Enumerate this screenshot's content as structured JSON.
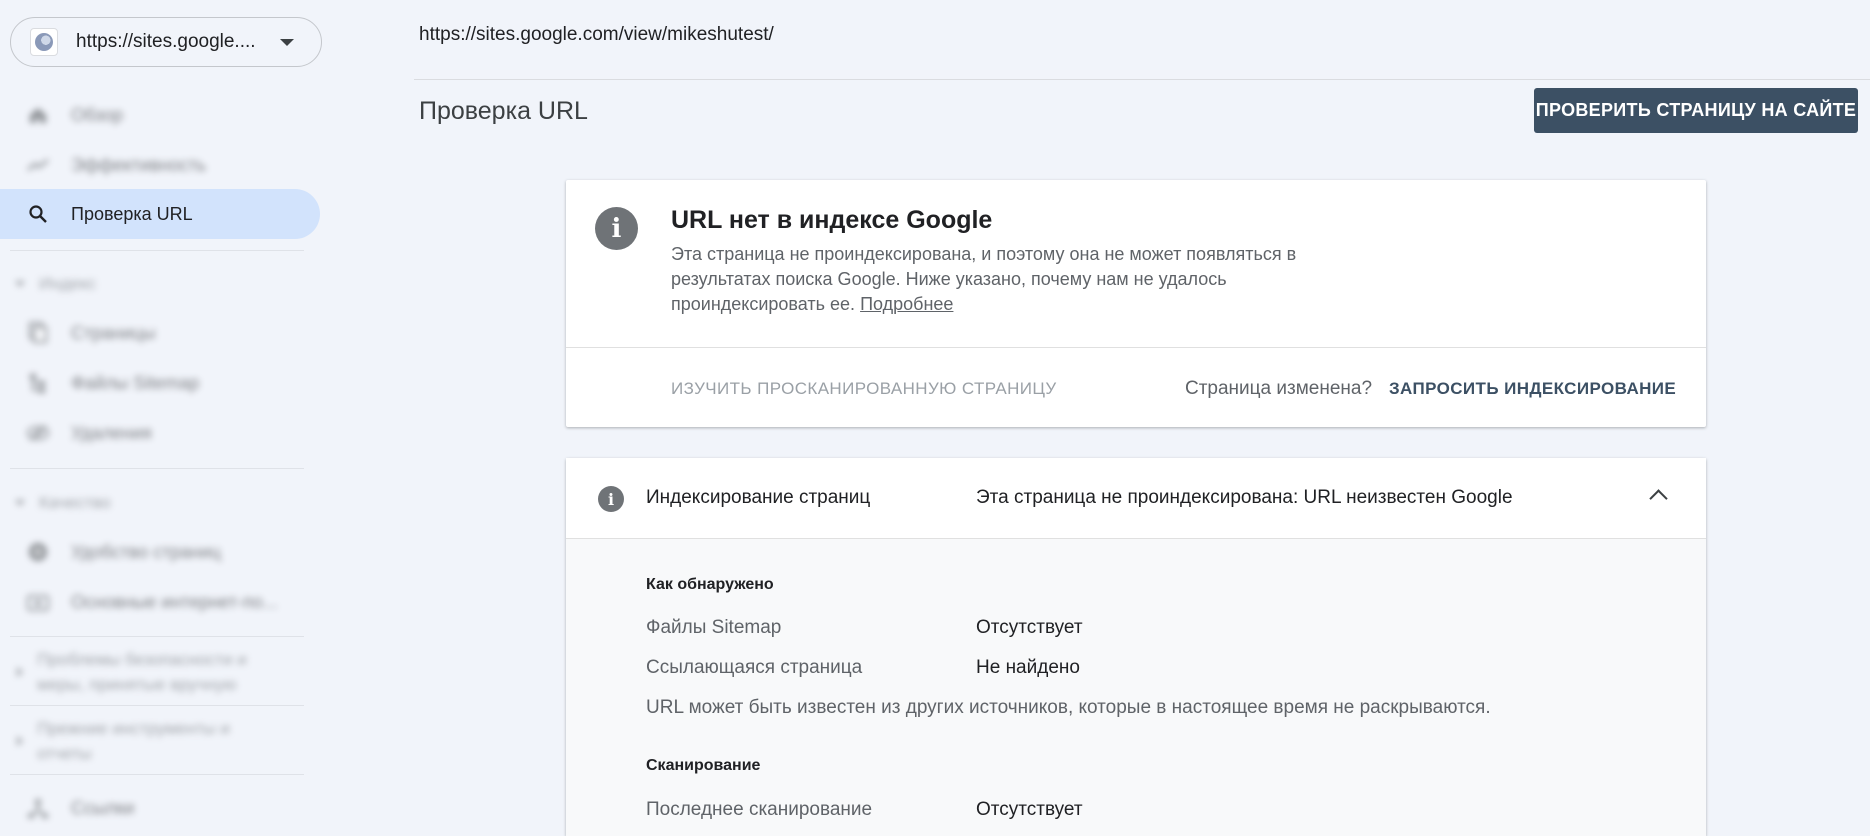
{
  "property": {
    "name": "https://sites.google....",
    "icon": "globe-icon"
  },
  "sidebar": {
    "items": [
      {
        "label": "Обзор",
        "icon": "home-icon"
      },
      {
        "label": "Эффективность",
        "icon": "trending-icon"
      },
      {
        "label": "Проверка URL",
        "icon": "search-icon"
      },
      {
        "label": "Страницы",
        "icon": "pages-icon"
      },
      {
        "label": "Файлы Sitemap",
        "icon": "sitemap-icon"
      },
      {
        "label": "Удаления",
        "icon": "removals-icon"
      },
      {
        "label": "Удобство страниц",
        "icon": "page-experience-icon"
      },
      {
        "label": "Основные интернет-по...",
        "icon": "web-vitals-icon"
      },
      {
        "label": "Ссылки",
        "icon": "links-icon"
      }
    ],
    "sections": {
      "index": "Индекс",
      "quality": "Качество",
      "security": "Проблемы безопасности и меры, принятые вручную",
      "legacy": "Прежние инструменты и отчеты"
    }
  },
  "header": {
    "url": "https://sites.google.com/view/mikeshutest/",
    "title": "Проверка URL",
    "test_button": "ПРОВЕРИТЬ СТРАНИЦУ НА САЙТЕ"
  },
  "status_card": {
    "heading": "URL нет в индексе Google",
    "description": "Эта страница не проиндексирована, и поэтому она не может появляться в результатах поиска Google. Ниже указано, почему нам не удалось проиндексировать ее.",
    "learn_more": "Подробнее",
    "inspect_link": "ИЗУЧИТЬ ПРОСКАНИРОВАННУЮ СТРАНИЦУ",
    "changed_question": "Страница изменена?",
    "request_indexing": "ЗАПРОСИТЬ ИНДЕКСИРОВАНИЕ"
  },
  "indexing_card": {
    "title": "Индексирование страниц",
    "status": "Эта страница не проиндексирована: URL неизвестен Google",
    "discovery": {
      "heading": "Как обнаружено",
      "rows": [
        {
          "key": "Файлы Sitemap",
          "value": "Отсутствует"
        },
        {
          "key": "Ссылающаяся страница",
          "value": "Не найдено"
        }
      ],
      "note": "URL может быть известен из других источников, которые в настоящее время не раскрываются."
    },
    "crawl": {
      "heading": "Сканирование",
      "rows": [
        {
          "key": "Последнее сканирование",
          "value": "Отсутствует"
        }
      ]
    }
  }
}
